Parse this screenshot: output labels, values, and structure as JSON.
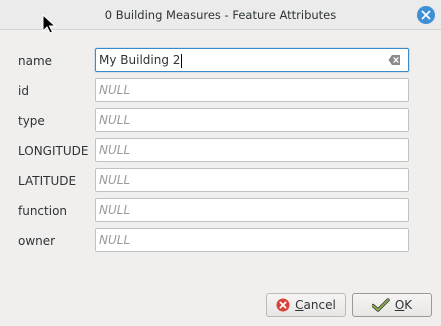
{
  "window": {
    "title": "0 Building Measures - Feature Attributes"
  },
  "fields": [
    {
      "label": "name",
      "value": "My Building 2",
      "is_null": false
    },
    {
      "label": "id",
      "value": "NULL",
      "is_null": true
    },
    {
      "label": "type",
      "value": "NULL",
      "is_null": true
    },
    {
      "label": "LONGITUDE",
      "value": "NULL",
      "is_null": true
    },
    {
      "label": "LATITUDE",
      "value": "NULL",
      "is_null": true
    },
    {
      "label": "function",
      "value": "NULL",
      "is_null": true
    },
    {
      "label": "owner",
      "value": "NULL",
      "is_null": true
    }
  ],
  "buttons": {
    "cancel_first": "C",
    "cancel_rest": "ancel",
    "ok_first": "O",
    "ok_rest": "K"
  },
  "colors": {
    "accent": "#3d8fd6",
    "cancel_icon": "#d9423b",
    "ok_icon": "#6a8a3a"
  }
}
